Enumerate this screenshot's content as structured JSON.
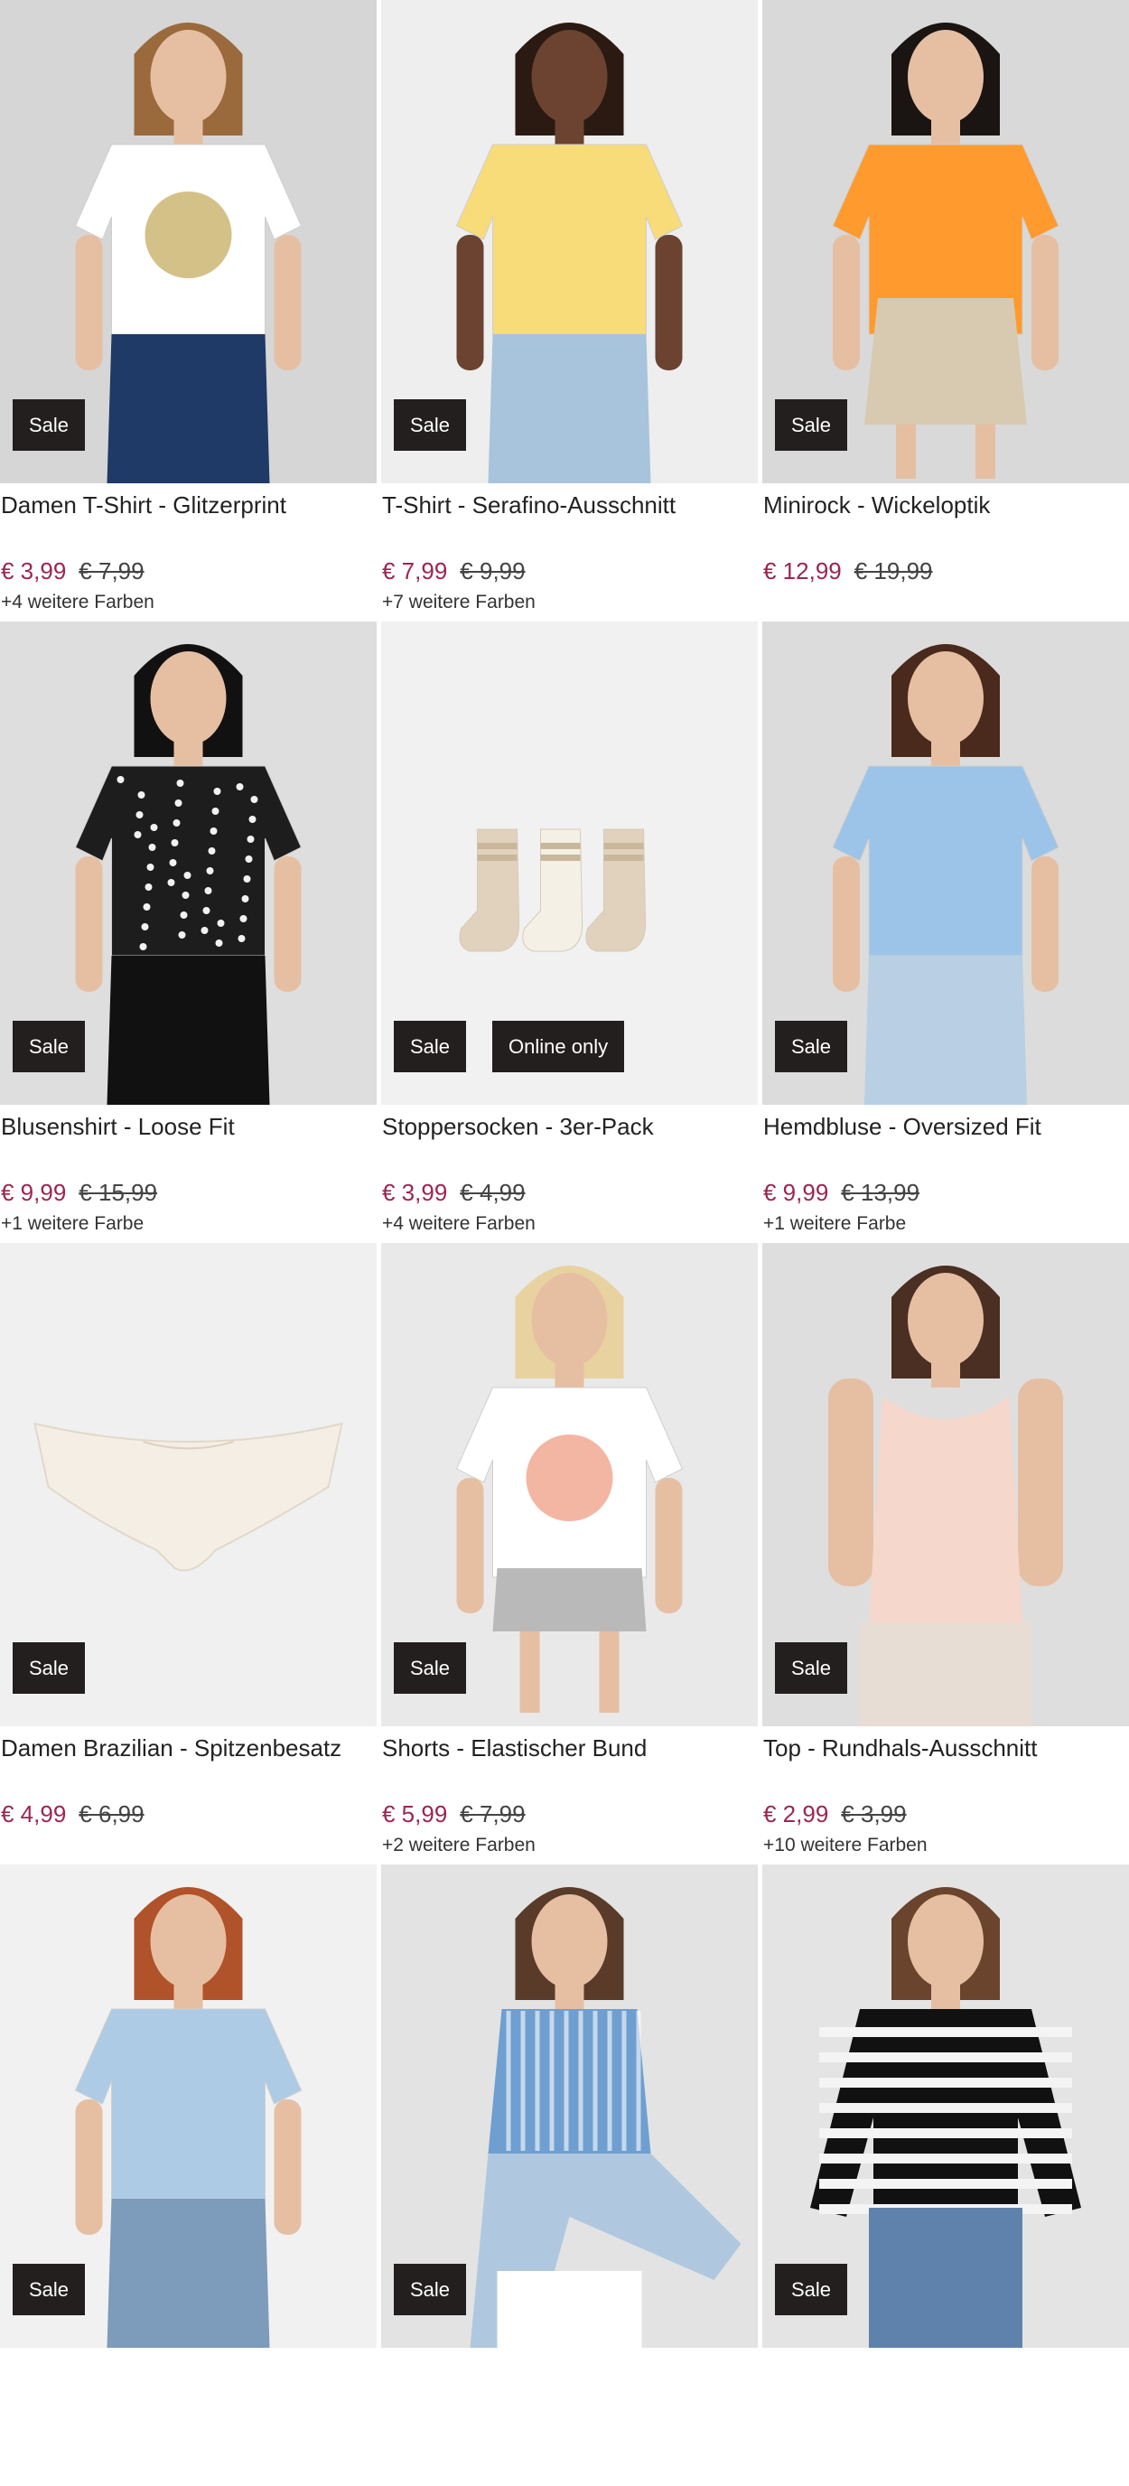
{
  "products": [
    {
      "name": "Damen T-Shirt - Glitzerprint",
      "price": "€ 3,99",
      "old_price": "€ 7,99",
      "colors_note": "+4 weitere Farben",
      "badges": [
        "Sale"
      ],
      "image": {
        "kind": "model-shirt",
        "bg": "#d6d6d6",
        "main_color": "#ffffff",
        "bottom_color": "#1f3a66",
        "hair_color": "#9a6a3c",
        "print_color": "#c9b26a"
      }
    },
    {
      "name": "T-Shirt - Serafino-Ausschnitt",
      "price": "€ 7,99",
      "old_price": "€ 9,99",
      "colors_note": "+7 weitere Farben",
      "badges": [
        "Sale"
      ],
      "image": {
        "kind": "model-shirt",
        "bg": "#eeeeee",
        "main_color": "#f7dc79",
        "bottom_color": "#a7c4dc",
        "hair_color": "#2a1a12",
        "skin": "#6b4330",
        "print_color": ""
      }
    },
    {
      "name": "Minirock - Wickeloptik",
      "price": "€ 12,99",
      "old_price": "€ 19,99",
      "colors_note": "",
      "badges": [
        "Sale"
      ],
      "image": {
        "kind": "model-skirt",
        "bg": "#d9d9d9",
        "main_color": "#ff9a2e",
        "bottom_color": "#d8cab0",
        "hair_color": "#1a1412"
      }
    },
    {
      "name": "Blusenshirt - Loose Fit",
      "price": "€ 9,99",
      "old_price": "€ 15,99",
      "colors_note": "+1 weitere Farbe",
      "badges": [
        "Sale"
      ],
      "image": {
        "kind": "model-shirt",
        "bg": "#dedede",
        "main_color": "#1d1d1d",
        "bottom_color": "#111111",
        "hair_color": "#111111",
        "print_color": "#f2f2f2"
      }
    },
    {
      "name": "Stoppersocken - 3er-Pack",
      "price": "€ 3,99",
      "old_price": "€ 4,99",
      "colors_note": "+4 weitere Farben",
      "badges": [
        "Sale",
        "Online only"
      ],
      "image": {
        "kind": "socks",
        "bg": "#f1f1f1",
        "main_color": "#e0d2bd",
        "bottom_color": "#f4f0e6"
      }
    },
    {
      "name": "Hemdbluse - Oversized Fit",
      "price": "€ 9,99",
      "old_price": "€ 13,99",
      "colors_note": "+1 weitere Farbe",
      "badges": [
        "Sale"
      ],
      "image": {
        "kind": "model-shirt",
        "bg": "#dcdcdc",
        "main_color": "#9cc4e8",
        "bottom_color": "#b8cfe4",
        "hair_color": "#4a2a1c",
        "print_color": ""
      }
    },
    {
      "name": "Damen Brazilian - Spitzenbesatz",
      "price": "€ 4,99",
      "old_price": "€ 6,99",
      "colors_note": "",
      "badges": [
        "Sale"
      ],
      "image": {
        "kind": "panty",
        "bg": "#f0f0f0",
        "main_color": "#f5eee4"
      }
    },
    {
      "name": "Shorts - Elastischer Bund",
      "price": "€ 5,99",
      "old_price": "€ 7,99",
      "colors_note": "+2 weitere Farben",
      "badges": [
        "Sale"
      ],
      "image": {
        "kind": "model-shorts",
        "bg": "#e9e9e9",
        "main_color": "#ffffff",
        "bottom_color": "#b9b9b9",
        "hair_color": "#e8d2a0",
        "print_color": "#f0a48c"
      }
    },
    {
      "name": "Top - Rundhals-Ausschnitt",
      "price": "€ 2,99",
      "old_price": "€ 3,99",
      "colors_note": "+10 weitere Farben",
      "badges": [
        "Sale"
      ],
      "image": {
        "kind": "model-top",
        "bg": "#dedede",
        "main_color": "#f6d7cc",
        "bottom_color": "#e8ddd4",
        "hair_color": "#4a2f22"
      }
    },
    {
      "name": "",
      "price": "",
      "old_price": "",
      "colors_note": "",
      "badges": [
        "Sale"
      ],
      "image": {
        "kind": "model-shirt",
        "bg": "#f1f1f1",
        "main_color": "#aecbe6",
        "bottom_color": "#7d9bbb",
        "hair_color": "#b0522a",
        "print_color": ""
      }
    },
    {
      "name": "",
      "price": "",
      "old_price": "",
      "colors_note": "",
      "badges": [
        "Sale"
      ],
      "image": {
        "kind": "model-sitting",
        "bg": "#e3e3e3",
        "main_color": "#6f9fd0",
        "bottom_color": "#b0c8df",
        "hair_color": "#5a3a28"
      }
    },
    {
      "name": "",
      "price": "",
      "old_price": "",
      "colors_note": "",
      "badges": [
        "Sale"
      ],
      "image": {
        "kind": "model-stripes",
        "bg": "#e4e4e4",
        "main_color": "#111111",
        "bottom_color": "#5f82ad",
        "hair_color": "#6a442c"
      }
    }
  ]
}
